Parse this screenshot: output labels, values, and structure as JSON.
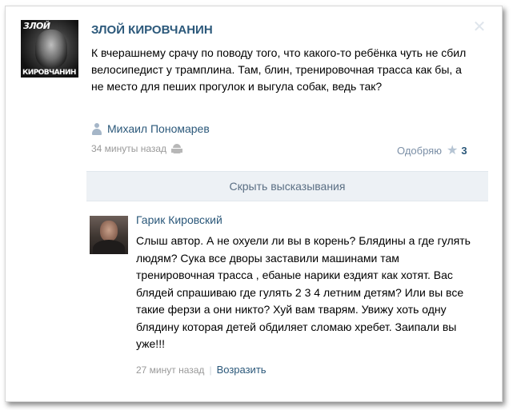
{
  "post": {
    "author": "ЗЛОЙ КИРОВЧАНИН",
    "avatar_text_top": "ЗЛОЙ",
    "avatar_text_bottom": "КИРОВЧАНИН",
    "text": "К вчерашнему срачу по поводу того, что какого-то ребёнка чуть не сбил велосипедист у трамплина. Там, блин, тренировочная трасса как бы, а не место для пеших прогулок и выгула собак, ведь так?",
    "signer": "Михаил Пономарев",
    "time": "34 минуты назад",
    "like_label": "Одобряю",
    "like_count": "3"
  },
  "hide_replies_label": "Скрыть высказывания",
  "reply": {
    "author": "Гарик Кировский",
    "text": "Слыш автор. А не охуели ли вы в корень? Блядины а где гулять людям? Сука все дворы заставили машинами там тренировочная трасса , ебаные нарики ездият как хотят. Вас блядей спрашиваю где гулять 2 3 4 летним детям? Или вы все такие ферзи а они никто? Хуй вам тварям. Увижу хоть одну блядину которая детей обдиляет сломаю хребет. Заипали вы уже!!!",
    "time": "27 минут назад",
    "separator": "|",
    "reply_label": "Возразить"
  },
  "icons": {
    "close": "close-icon",
    "person": "person-icon",
    "android": "android-icon",
    "star": "star-icon"
  },
  "colors": {
    "link": "#2b587a",
    "meta": "#999999",
    "hide_bar_bg": "#edf1f5"
  }
}
